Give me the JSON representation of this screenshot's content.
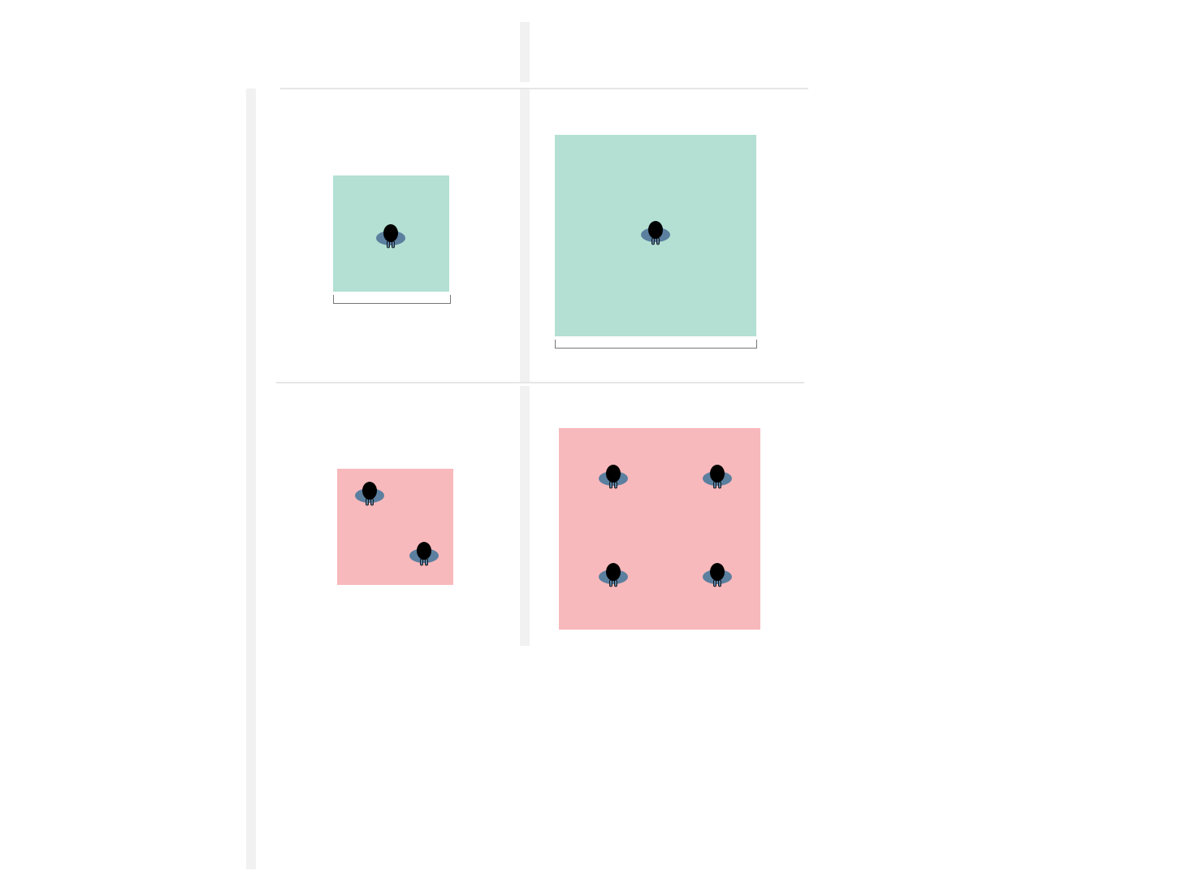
{
  "colors": {
    "background": "#ffffff",
    "bar": "#f1f1f1",
    "line": "#e6e6e6",
    "single": "#b3e0d3",
    "multi": "#f8b9bc",
    "person_body": "#5b7f9f",
    "person_head": "#000000",
    "bracket": "#777777"
  },
  "grid": {
    "rows": [
      "single",
      "multi"
    ],
    "columns": [
      "small",
      "large"
    ]
  },
  "panels": [
    {
      "id": "single-small",
      "kind": "single",
      "people": 1,
      "scale_label": ""
    },
    {
      "id": "single-large",
      "kind": "single",
      "people": 1,
      "scale_label": ""
    },
    {
      "id": "multi-small",
      "kind": "multi",
      "people": 2
    },
    {
      "id": "multi-large",
      "kind": "multi",
      "people": 4
    }
  ],
  "icons": {
    "person": "person-top-view-icon",
    "scale": "scale-bracket-icon"
  }
}
